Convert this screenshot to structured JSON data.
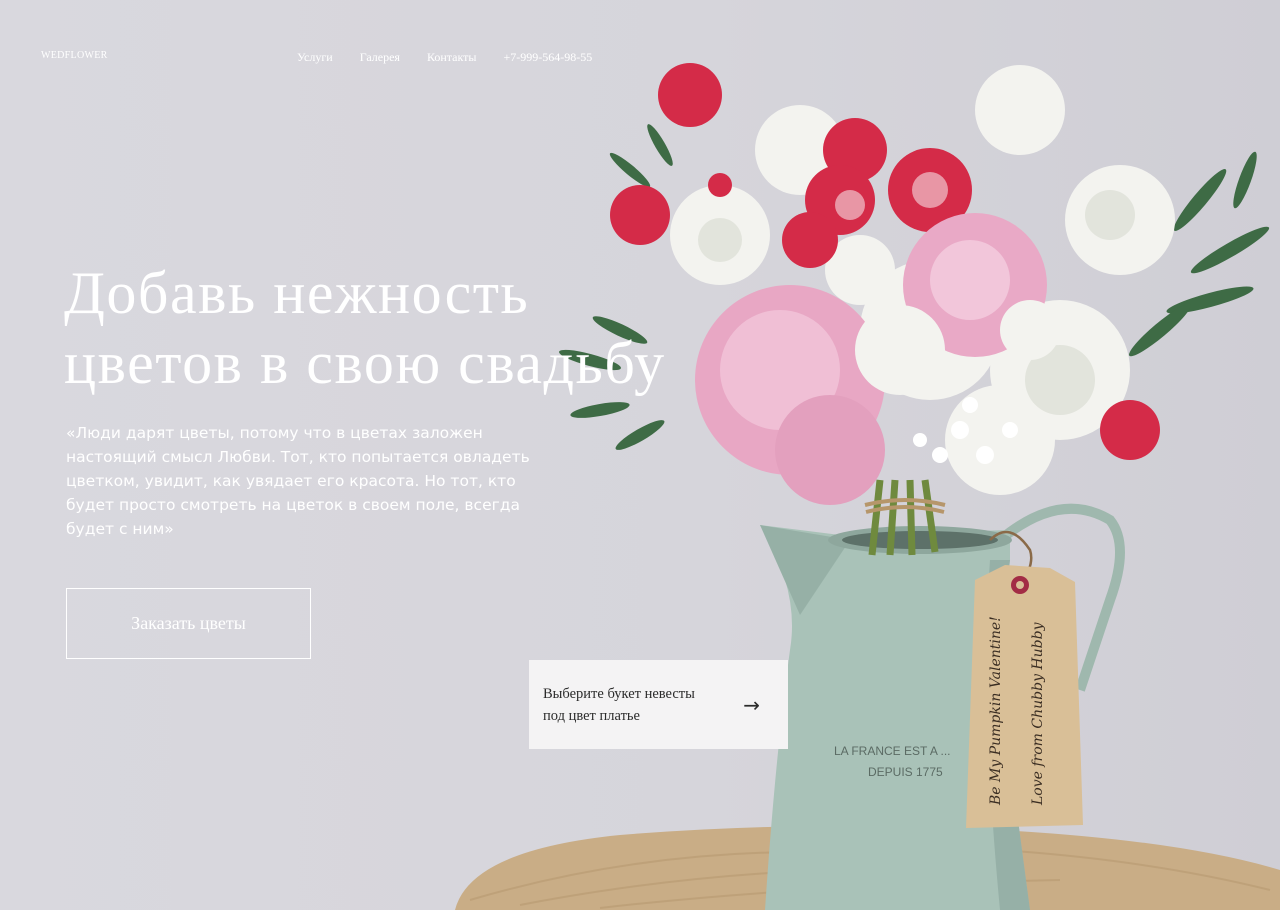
{
  "header": {
    "logo": "WEDFLOWER",
    "nav": [
      {
        "label": "Услуги"
      },
      {
        "label": "Галерея"
      },
      {
        "label": "Контакты"
      },
      {
        "label": "+7-999-564-98-55"
      }
    ]
  },
  "hero": {
    "title_line1": "Добавь нежность",
    "title_line2": "цветов в свою свадьбу",
    "quote": "«Люди дарят цветы, потому что в цветах заложен настоящий смысл Любви. Тот, кто попытается овладеть цветком, увидит, как увядает его красота. Но тот, кто будет просто смотреть на цветок в своем поле, всегда будет с ним»",
    "order_button": "Заказать цветы"
  },
  "card": {
    "line1": "Выберите букет невесты",
    "line2": "под цвет платье",
    "arrow": "→"
  },
  "photo": {
    "vase_text_line1": "LA FRANCE EST A ...",
    "vase_text_line2": "DEPUIS 1775",
    "tag_text_line1": "Be My Pumpkin Valentine!",
    "tag_text_line2": "Love from Chubby Hubby"
  },
  "colors": {
    "background": "#d6d5db",
    "text_light": "#ffffff",
    "card_bg": "#f4f3f4",
    "card_text": "#2b2b2b",
    "vase": "#a9c2b8",
    "tag": "#d9bf97",
    "burlap": "#c9ad86",
    "peony_pink": "#e8a7c4",
    "carnation_red": "#d42b48"
  }
}
